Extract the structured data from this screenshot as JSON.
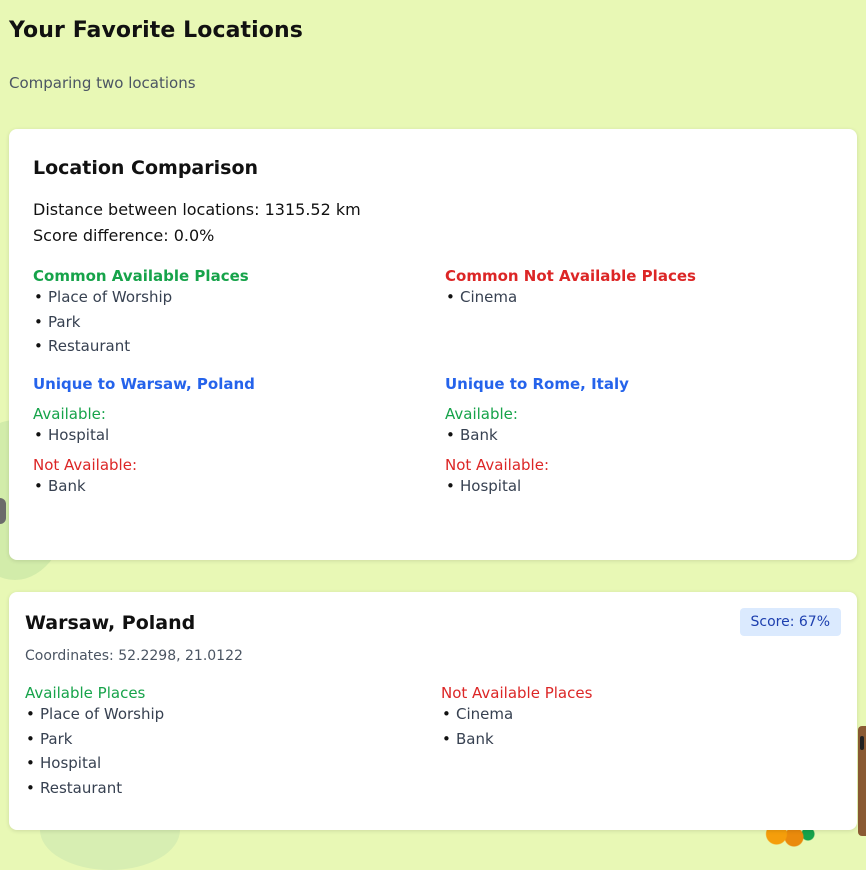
{
  "page": {
    "title": "Your Favorite Locations",
    "subtitle": "Comparing two locations"
  },
  "comparison": {
    "title": "Location Comparison",
    "distance_text": "Distance between locations: 1315.52 km",
    "score_diff_text": "Score difference: 0.0%",
    "common_available": {
      "heading": "Common Available Places",
      "items": [
        "Place of Worship",
        "Park",
        "Restaurant"
      ]
    },
    "common_not_available": {
      "heading": "Common Not Available Places",
      "items": [
        "Cinema"
      ]
    },
    "unique_a": {
      "heading": "Unique to Warsaw, Poland",
      "available_label": "Available:",
      "available": [
        "Hospital"
      ],
      "not_available_label": "Not Available:",
      "not_available": [
        "Bank"
      ]
    },
    "unique_b": {
      "heading": "Unique to Rome, Italy",
      "available_label": "Available:",
      "available": [
        "Bank"
      ],
      "not_available_label": "Not Available:",
      "not_available": [
        "Hospital"
      ]
    }
  },
  "location_card": {
    "name": "Warsaw, Poland",
    "score": "Score: 67%",
    "coordinates": "Coordinates: 52.2298, 21.0122",
    "available_heading": "Available Places",
    "available": [
      "Place of Worship",
      "Park",
      "Hospital",
      "Restaurant"
    ],
    "not_available_heading": "Not Available Places",
    "not_available": [
      "Cinema",
      "Bank"
    ]
  },
  "colors": {
    "background": "#e8f8b5",
    "available": "#16a34a",
    "not_available": "#dc2626",
    "unique": "#2563eb",
    "score_badge_bg": "#dbeafe"
  }
}
